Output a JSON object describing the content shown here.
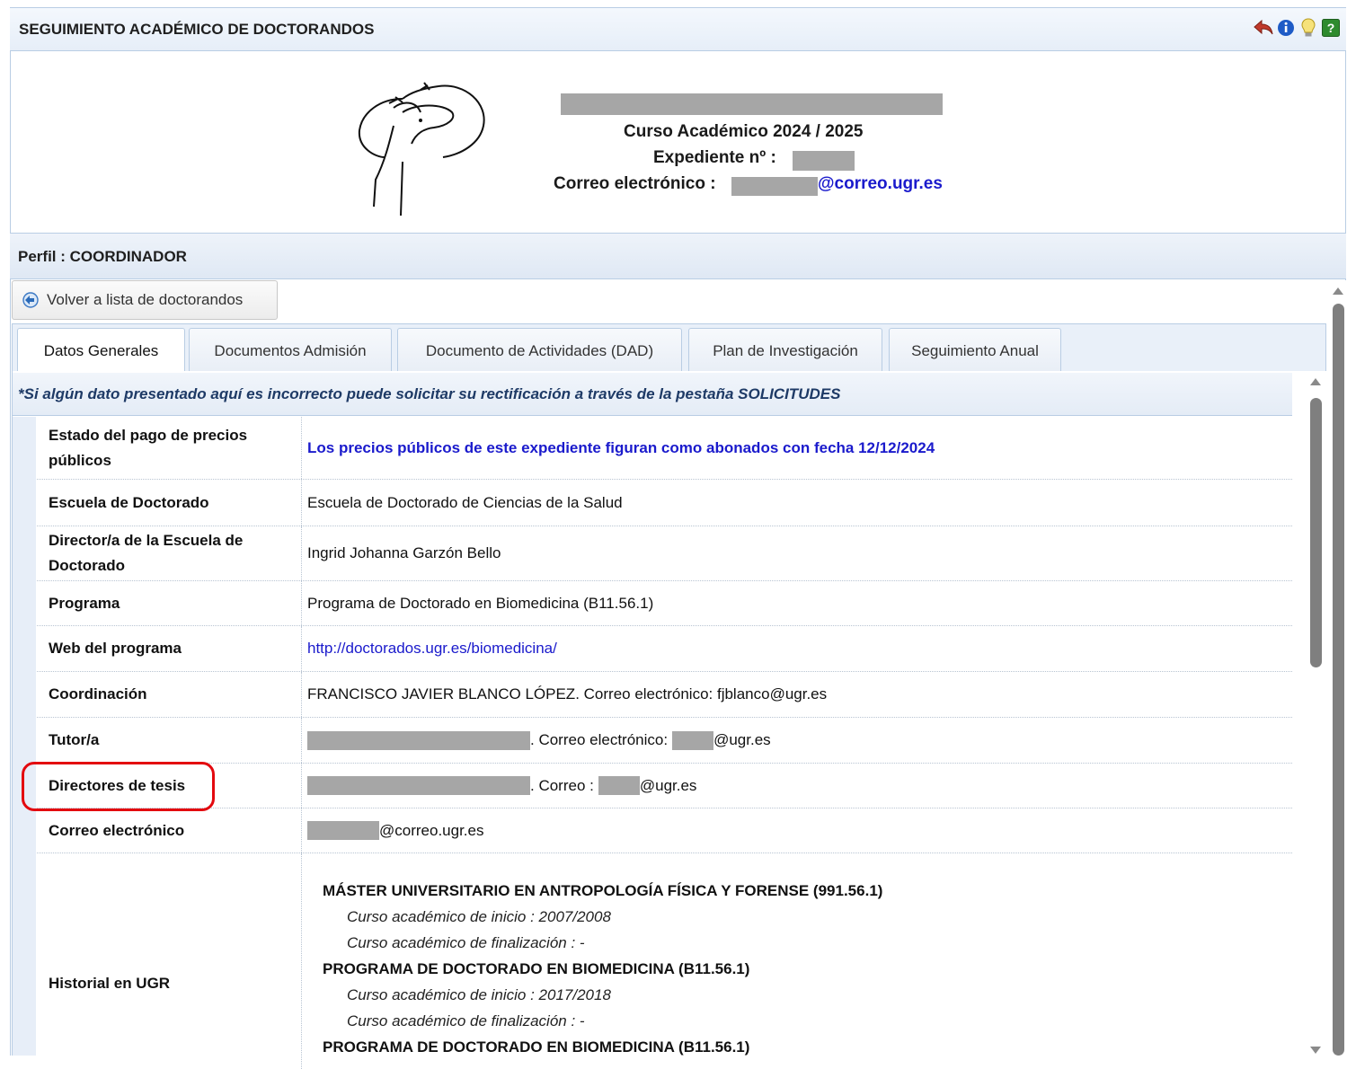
{
  "app": {
    "title": "SEGUIMIENTO ACADÉMICO DE DOCTORANDOS",
    "toolbar_icons": [
      "back-arrow-icon",
      "info-icon",
      "lightbulb-icon",
      "help-icon"
    ]
  },
  "header": {
    "course": "Curso Académico 2024 / 2025",
    "expediente_label": "Expediente nº :",
    "email_label": "Correo electrónico :",
    "email_domain": "@correo.ugr.es"
  },
  "profile": {
    "label": "Perfil : COORDINADOR"
  },
  "back_button": {
    "label": "Volver a lista de doctorandos"
  },
  "tabs": [
    {
      "label": "Datos Generales",
      "active": true
    },
    {
      "label": "Documentos Admisión",
      "active": false
    },
    {
      "label": "Documento de Actividades (DAD)",
      "active": false
    },
    {
      "label": "Plan de Investigación",
      "active": false
    },
    {
      "label": "Seguimiento Anual",
      "active": false
    }
  ],
  "notice": "*Si algún dato presentado aquí es incorrecto puede solicitar su rectificación a través de la pestaña SOLICITUDES",
  "rows": {
    "pago": {
      "label": "Estado del pago de precios públicos",
      "value": "Los precios públicos de este expediente figuran como abonados con fecha 12/12/2024"
    },
    "escuela": {
      "label": "Escuela de Doctorado",
      "value": "Escuela de Doctorado de Ciencias de la Salud"
    },
    "director_escuela": {
      "label": "Director/a de la Escuela de Doctorado",
      "value": "Ingrid Johanna Garzón Bello"
    },
    "programa": {
      "label": "Programa",
      "value": "Programa de Doctorado en Biomedicina (B11.56.1)"
    },
    "web": {
      "label": "Web del programa",
      "value": "http://doctorados.ugr.es/biomedicina/"
    },
    "coordinacion": {
      "label": "Coordinación",
      "value": "FRANCISCO JAVIER BLANCO LÓPEZ. Correo electrónico: fjblanco@ugr.es"
    },
    "tutor": {
      "label": "Tutor/a",
      "mid": ". Correo electrónico:",
      "domain": "@ugr.es"
    },
    "directores": {
      "label": "Directores de tesis",
      "mid": ". Correo :",
      "domain": "@ugr.es"
    },
    "correo": {
      "label": "Correo electrónico",
      "domain": "@correo.ugr.es"
    },
    "historial": {
      "label": "Historial en UGR",
      "entries": [
        {
          "title": "MÁSTER UNIVERSITARIO EN ANTROPOLOGÍA FÍSICA Y FORENSE (991.56.1)",
          "inicio": "Curso académico de inicio : 2007/2008",
          "fin": "Curso académico de finalización : -"
        },
        {
          "title": "PROGRAMA DE DOCTORADO EN BIOMEDICINA (B11.56.1)",
          "inicio": "Curso académico de inicio : 2017/2018",
          "fin": "Curso académico de finalización : -"
        },
        {
          "title": "PROGRAMA DE DOCTORADO EN BIOMEDICINA (B11.56.1)"
        }
      ]
    }
  }
}
